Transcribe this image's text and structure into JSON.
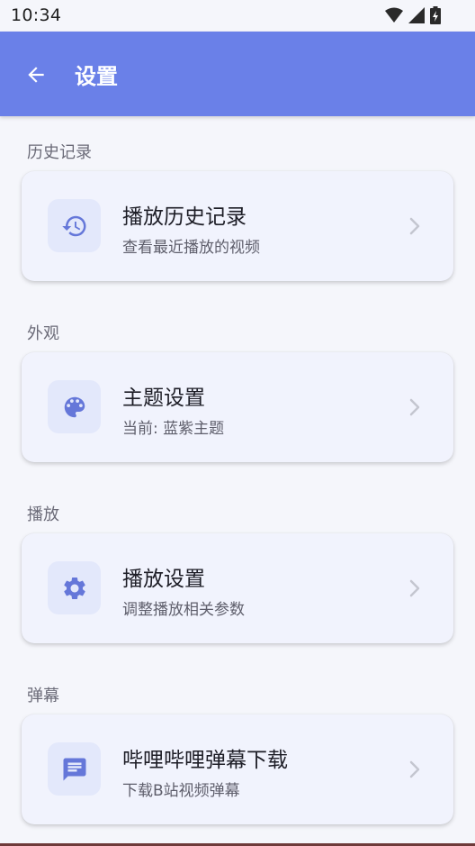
{
  "status_bar": {
    "time": "10:34"
  },
  "app_bar": {
    "title": "设置"
  },
  "sections": [
    {
      "label": "历史记录",
      "card": {
        "icon": "history-icon",
        "title": "播放历史记录",
        "subtitle": "查看最近播放的视频"
      }
    },
    {
      "label": "外观",
      "card": {
        "icon": "palette-icon",
        "title": "主题设置",
        "subtitle": "当前: 蓝紫主题"
      }
    },
    {
      "label": "播放",
      "card": {
        "icon": "gear-icon",
        "title": "播放设置",
        "subtitle": "调整播放相关参数"
      }
    },
    {
      "label": "弹幕",
      "card": {
        "icon": "message-icon",
        "title": "哔哩哔哩弹幕下载",
        "subtitle": "下载B站视频弹幕"
      }
    }
  ],
  "colors": {
    "accent": "#6a80e8",
    "icon": "#6577d9",
    "card_bg": "#f1f3fd",
    "icon_bg": "#e3e8fb"
  }
}
